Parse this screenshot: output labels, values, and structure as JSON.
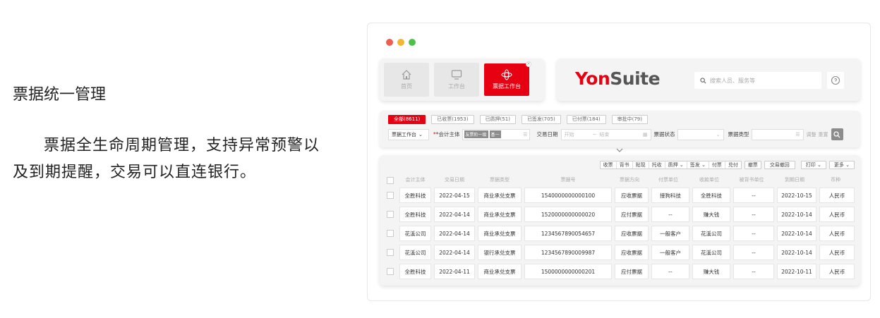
{
  "intro": {
    "title": "票据统一管理",
    "body": "票据全生命周期管理，支持异常预警以及到期提醒，交易可以直连银行。"
  },
  "window": {
    "dots": [
      "#ee5d50",
      "#f3b62d",
      "#4cc24b"
    ]
  },
  "nav": {
    "items": [
      {
        "label": "首页",
        "icon": "home-icon"
      },
      {
        "label": "工作台",
        "icon": "monitor-icon"
      },
      {
        "label": "票据工作台",
        "icon": "bill-workbench-icon",
        "active": true
      }
    ]
  },
  "brand": {
    "logo_a": "Yon",
    "logo_b": "Suite",
    "search_placeholder": "搜索人员、服务等",
    "accent": "#e60012"
  },
  "filters": {
    "tabs": [
      "全部(8611)",
      "已收票(1953)",
      "已质押(51)",
      "已签发(705)",
      "已付票(184)",
      "审批中(79)"
    ],
    "workbench": "票据工作台",
    "entity_label": "*会计主体",
    "entity_chip1": "友票阶一级",
    "entity_chip2": "基一",
    "date_label": "交易日期",
    "date_start": "开始",
    "date_sep": "~",
    "date_end": "结束",
    "status_label": "票据状态",
    "type_label": "票据类型",
    "adjust": "调整",
    "reset": "重置"
  },
  "toolbar": {
    "group1": [
      "收票",
      "背书",
      "贴现",
      "托收",
      "质押 ⌄",
      "签发 ⌄",
      "付票",
      "兑付"
    ],
    "withdraw": "撤票",
    "trade_revoke": "交易撤回",
    "print": "打印 ⌄",
    "more": "更多 ⌄"
  },
  "table": {
    "columns": [
      "会计主体",
      "交易日期",
      "票据类型",
      "票据号",
      "票据方向",
      "付票单位",
      "收款单位",
      "被背书单位",
      "到期日期",
      "币种"
    ],
    "rows": [
      [
        "全胜科技",
        "2022-04-15",
        "商业承兑支票",
        "1540000000000100",
        "应收票据",
        "接狗科技",
        "全胜科技",
        "--",
        "2022-10-15",
        "人民币"
      ],
      [
        "全胜科技",
        "2022-04-14",
        "商业承兑支票",
        "1520000000000020",
        "应付票据",
        "--",
        "赚大钱",
        "--",
        "2022-10-14",
        "人民币"
      ],
      [
        "花溪公司",
        "2022-04-14",
        "商业承兑支票",
        "1234567890054657",
        "应收票据",
        "一般客户",
        "花溪公司",
        "--",
        "2022-10-14",
        "人民币"
      ],
      [
        "花溪公司",
        "2022-04-14",
        "银行承兑支票",
        "1234567890009987",
        "应收票据",
        "一般客户",
        "花溪公司",
        "--",
        "2022-10-14",
        "人民币"
      ],
      [
        "全胜科技",
        "2022-04-11",
        "商业承兑支票",
        "1500000000000201",
        "应付票据",
        "--",
        "赚大钱",
        "--",
        "2022-10-11",
        "人民币"
      ]
    ]
  }
}
